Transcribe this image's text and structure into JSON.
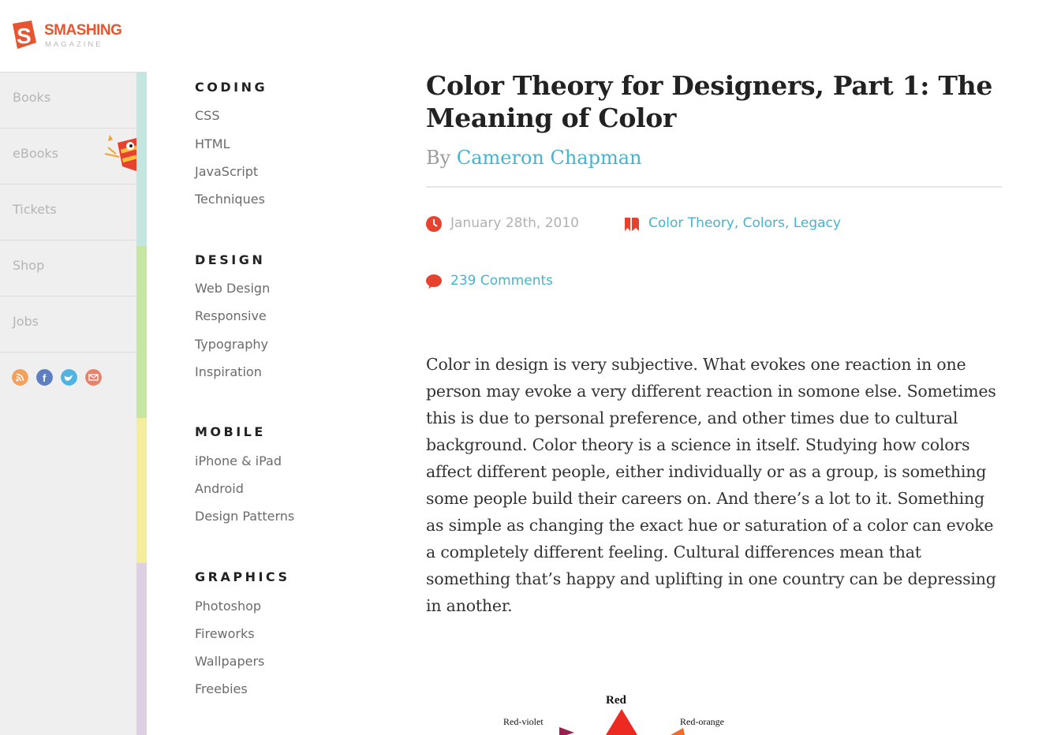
{
  "logo": {
    "word1": "SMASHING",
    "word2": "MAGAZINE"
  },
  "leftnav": {
    "items": [
      {
        "label": "Books"
      },
      {
        "label": "eBooks"
      },
      {
        "label": "Tickets"
      },
      {
        "label": "Shop"
      },
      {
        "label": "Jobs"
      }
    ],
    "socials": [
      {
        "icon": "rss-icon",
        "color": "#f3a15c"
      },
      {
        "icon": "facebook-icon",
        "color": "#5d7fbf"
      },
      {
        "icon": "twitter-icon",
        "color": "#4fb3e6"
      },
      {
        "icon": "email-icon",
        "color": "#e9806b"
      }
    ]
  },
  "strip_colors": [
    "#c3e6e1",
    "#c6e6a2",
    "#f4ed9b",
    "#ddd0e2"
  ],
  "categories": [
    {
      "heading": "CODING",
      "links": [
        "CSS",
        "HTML",
        "JavaScript",
        "Techniques"
      ]
    },
    {
      "heading": "DESIGN",
      "links": [
        "Web Design",
        "Responsive",
        "Typography",
        "Inspiration"
      ]
    },
    {
      "heading": "MOBILE",
      "links": [
        "iPhone & iPad",
        "Android",
        "Design Patterns"
      ]
    },
    {
      "heading": "GRAPHICS",
      "links": [
        "Photoshop",
        "Fireworks",
        "Wallpapers",
        "Freebies"
      ]
    }
  ],
  "article": {
    "title": "Color Theory for Designers, Part 1: The Meaning of Color",
    "by": "By",
    "author": "Cameron Chapman",
    "date": "January 28th, 2010",
    "tags": "Color Theory, Colors, Legacy",
    "comments": "239 Comments",
    "body": "Color in design is very subjective. What evokes one reaction in one person may evoke a very different reaction in somone else. Sometimes this is due to personal preference, and other times due to cultural background. Color theory is a science in itself. Studying how colors affect different people, either individually or as a group, is something some people build their careers on. And there’s a lot to it. Something as simple as changing the exact hue or saturation of a color can evoke a completely different feeling. Cultural differences mean that something that’s happy and uplifting in one country can be depressing in another."
  },
  "wheel": {
    "labels": {
      "top": "Red",
      "left": "Red-violet",
      "right": "Red-orange"
    },
    "colors": {
      "red": "#ec2a22",
      "violet": "#9b1f4e",
      "orange": "#f06a2a"
    }
  },
  "accent": "#e8422f",
  "link_color": "#45b4cf"
}
